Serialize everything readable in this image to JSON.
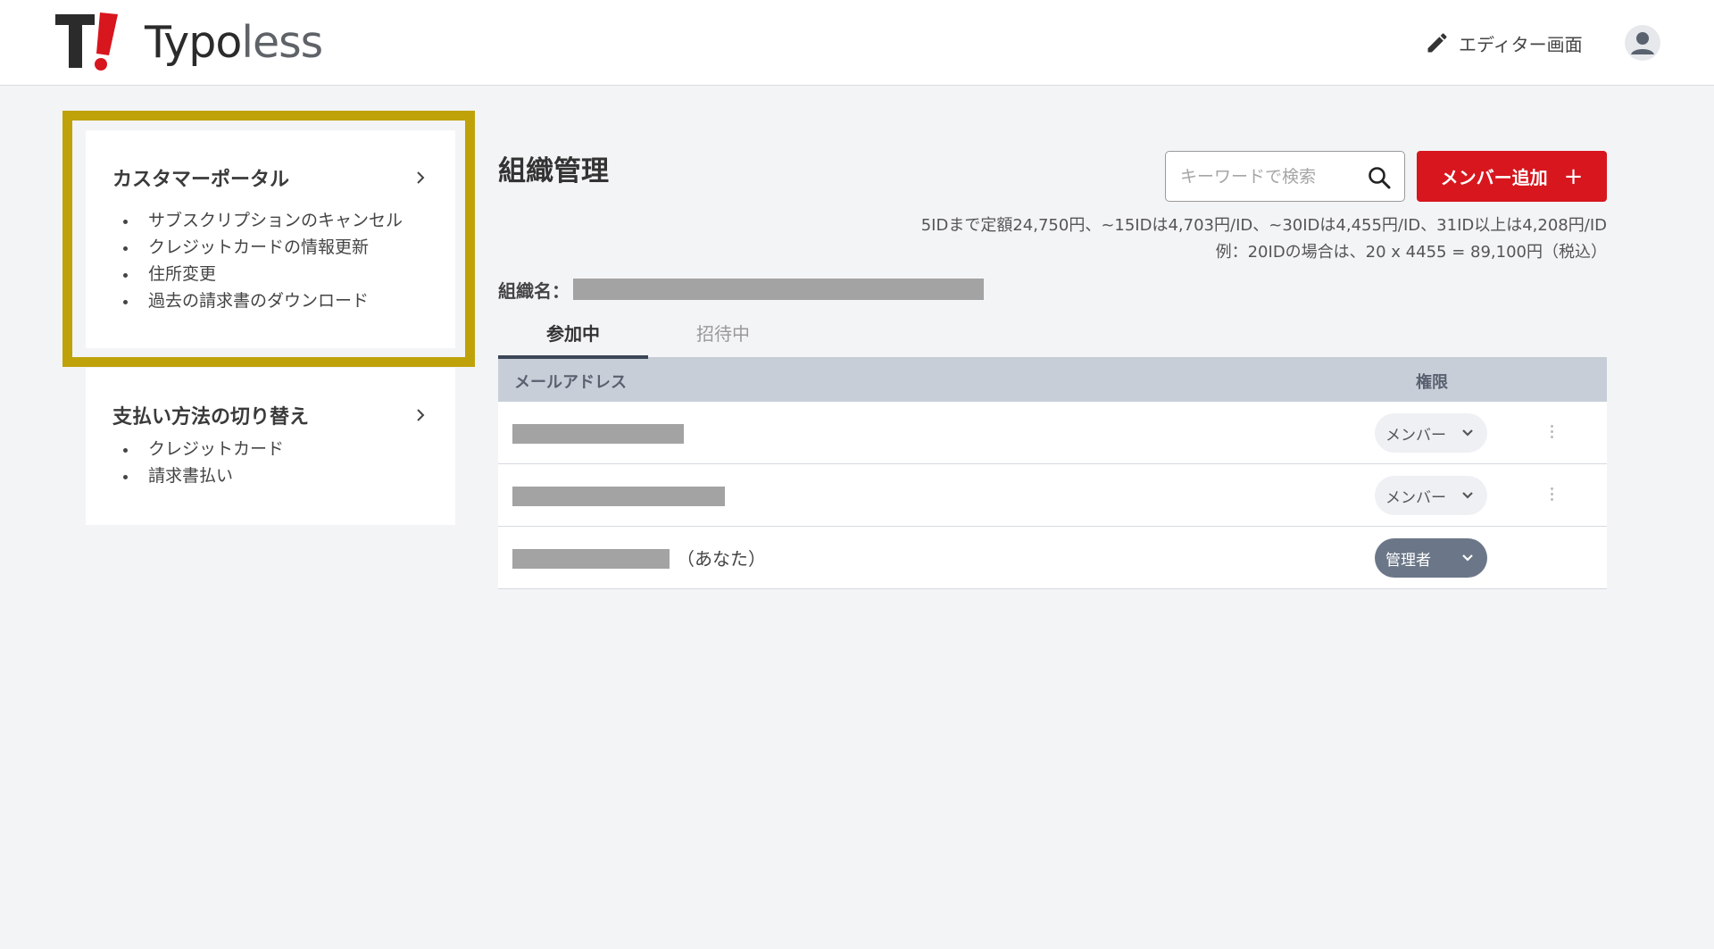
{
  "header": {
    "logo_text_strong": "Typo",
    "logo_text_light": "less",
    "editor_link_label": "エディター画面"
  },
  "sidebar": {
    "cards": [
      {
        "title": "カスタマーポータル",
        "items": [
          "サブスクリプションのキャンセル",
          "クレジットカードの情報更新",
          "住所変更",
          "過去の請求書のダウンロード"
        ]
      },
      {
        "title": "支払い方法の切り替え",
        "items": [
          "クレジットカード",
          "請求書払い"
        ]
      }
    ]
  },
  "main": {
    "title": "組織管理",
    "search_placeholder": "キーワードで検索",
    "add_member_label": "メンバー追加",
    "add_member_plus": "+",
    "pricing_line1": "5IDまで定額24,750円、~15IDは4,703円/ID、~30IDは4,455円/ID、31ID以上は4,208円/ID",
    "pricing_line2": "例：20IDの場合は、20 x 4455 = 89,100円（税込）",
    "org_name_label": "組織名：",
    "tabs": [
      {
        "label": "参加中",
        "active": true
      },
      {
        "label": "招待中",
        "active": false
      }
    ],
    "table": {
      "col_email": "メールアドレス",
      "col_role": "権限",
      "rows": [
        {
          "email_suffix": "",
          "role": "メンバー",
          "admin": false,
          "menu": true
        },
        {
          "email_suffix": "",
          "role": "メンバー",
          "admin": false,
          "menu": true
        },
        {
          "email_suffix": "（あなた）",
          "role": "管理者",
          "admin": true,
          "menu": false
        }
      ]
    }
  },
  "colors": {
    "brand_red": "#d7161e",
    "highlight": "#bfa20a",
    "admin_pill": "#6b7788",
    "table_header": "#c8ced8"
  },
  "icons": [
    "typoless-logo-icon",
    "pencil-icon",
    "user-avatar-icon",
    "chevron-right-icon",
    "search-icon",
    "chevron-down-icon",
    "kebab-menu-icon"
  ]
}
